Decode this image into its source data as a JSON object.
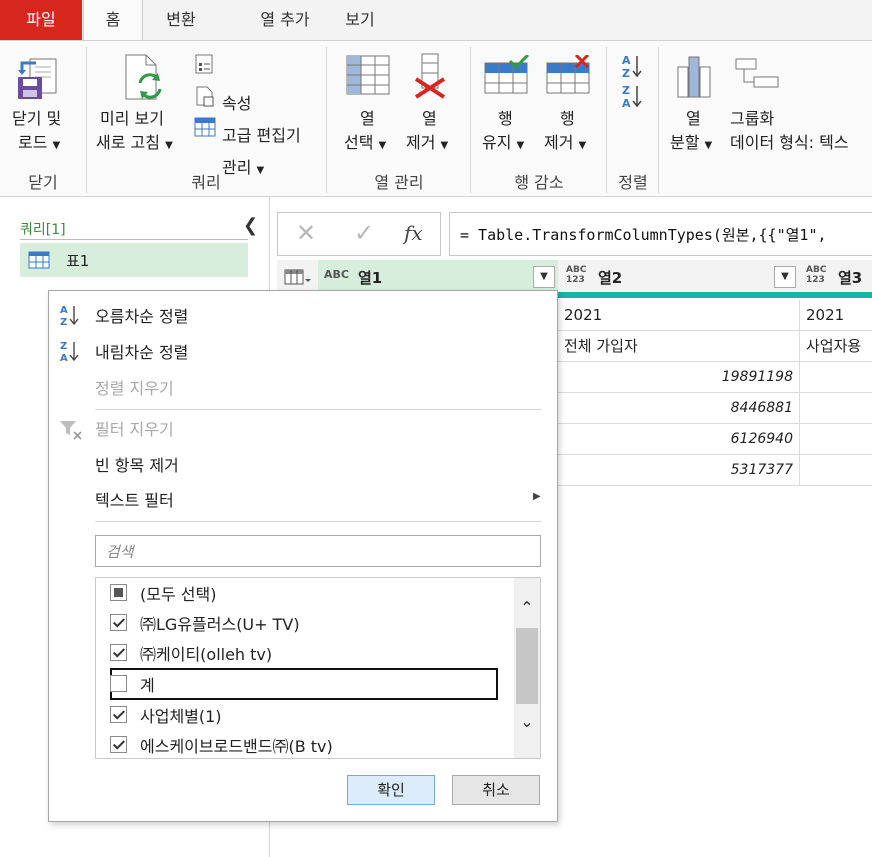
{
  "tabs": [
    {
      "label": "파일"
    },
    {
      "label": "홈"
    },
    {
      "label": "변환"
    },
    {
      "label": "열 추가"
    },
    {
      "label": "보기"
    }
  ],
  "ribbon": {
    "close_load_1": "닫기 및",
    "close_load_2": "로드",
    "preview_1": "미리 보기",
    "preview_2": "새로 고침",
    "properties": "속성",
    "advanced_editor": "고급 편집기",
    "manage": "관리",
    "choose_cols_1": "열",
    "choose_cols_2": "선택",
    "remove_cols_1": "열",
    "remove_cols_2": "제거",
    "keep_rows_1": "행",
    "keep_rows_2": "유지",
    "remove_rows_1": "행",
    "remove_rows_2": "제거",
    "split_col_1": "열",
    "split_col_2": "분할",
    "group_by": "그룹화",
    "data_type": "데이터 형식: 텍스",
    "groups": {
      "close": "닫기",
      "query": "쿼리",
      "manage_cols": "열 관리",
      "reduce_rows": "행 감소",
      "sort": "정렬"
    }
  },
  "queries": {
    "title": "쿼리[1]",
    "items": [
      {
        "label": "표1"
      }
    ]
  },
  "formula": {
    "text": "= Table.TransformColumnTypes(원본,{{\"열1\","
  },
  "grid": {
    "columns": [
      {
        "name": "열1",
        "type": "ABC"
      },
      {
        "name": "열2",
        "type": "ABC 123"
      },
      {
        "name": "열3",
        "type": "ABC 123"
      }
    ],
    "rows": [
      [
        "2021",
        "2021"
      ],
      [
        "전체 가입자",
        "사업자용"
      ],
      [
        "19891198",
        ""
      ],
      [
        "8446881",
        ""
      ],
      [
        "6126940",
        ""
      ],
      [
        "5317377",
        ""
      ]
    ]
  },
  "menu": {
    "sort_asc": "오름차순 정렬",
    "sort_desc": "내림차순 정렬",
    "clear_sort": "정렬 지우기",
    "clear_filter": "필터 지우기",
    "remove_empty": "빈 항목 제거",
    "text_filter": "텍스트 필터",
    "search_placeholder": "검색",
    "items": [
      {
        "label": "(모두 선택)",
        "state": "partial"
      },
      {
        "label": "㈜LG유플러스(U+ TV)",
        "state": "checked"
      },
      {
        "label": "㈜케이티(olleh tv)",
        "state": "checked"
      },
      {
        "label": "계",
        "state": "unchecked"
      },
      {
        "label": "사업체별(1)",
        "state": "checked"
      },
      {
        "label": "에스케이브로드밴드㈜(B tv)",
        "state": "checked"
      }
    ],
    "ok": "확인",
    "cancel": "취소"
  },
  "colors": {
    "file_tab": "#d7261e",
    "selected_query": "#d6eedb",
    "accent_teal": "#17b3a3",
    "ok_button": "#dcecfa"
  }
}
